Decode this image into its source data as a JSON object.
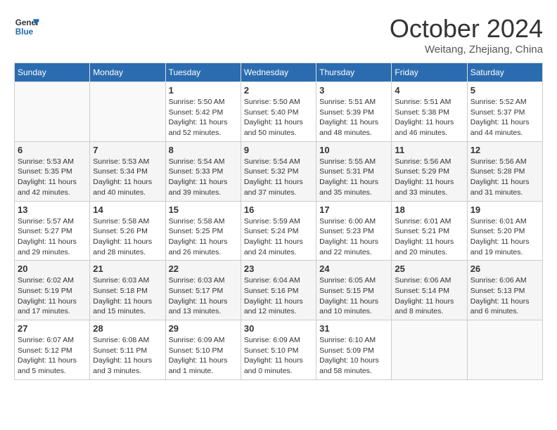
{
  "header": {
    "logo_line1": "General",
    "logo_line2": "Blue",
    "month": "October 2024",
    "location": "Weitang, Zhejiang, China"
  },
  "weekdays": [
    "Sunday",
    "Monday",
    "Tuesday",
    "Wednesday",
    "Thursday",
    "Friday",
    "Saturday"
  ],
  "weeks": [
    [
      {
        "day": "",
        "info": ""
      },
      {
        "day": "",
        "info": ""
      },
      {
        "day": "1",
        "info": "Sunrise: 5:50 AM\nSunset: 5:42 PM\nDaylight: 11 hours\nand 52 minutes."
      },
      {
        "day": "2",
        "info": "Sunrise: 5:50 AM\nSunset: 5:40 PM\nDaylight: 11 hours\nand 50 minutes."
      },
      {
        "day": "3",
        "info": "Sunrise: 5:51 AM\nSunset: 5:39 PM\nDaylight: 11 hours\nand 48 minutes."
      },
      {
        "day": "4",
        "info": "Sunrise: 5:51 AM\nSunset: 5:38 PM\nDaylight: 11 hours\nand 46 minutes."
      },
      {
        "day": "5",
        "info": "Sunrise: 5:52 AM\nSunset: 5:37 PM\nDaylight: 11 hours\nand 44 minutes."
      }
    ],
    [
      {
        "day": "6",
        "info": "Sunrise: 5:53 AM\nSunset: 5:35 PM\nDaylight: 11 hours\nand 42 minutes."
      },
      {
        "day": "7",
        "info": "Sunrise: 5:53 AM\nSunset: 5:34 PM\nDaylight: 11 hours\nand 40 minutes."
      },
      {
        "day": "8",
        "info": "Sunrise: 5:54 AM\nSunset: 5:33 PM\nDaylight: 11 hours\nand 39 minutes."
      },
      {
        "day": "9",
        "info": "Sunrise: 5:54 AM\nSunset: 5:32 PM\nDaylight: 11 hours\nand 37 minutes."
      },
      {
        "day": "10",
        "info": "Sunrise: 5:55 AM\nSunset: 5:31 PM\nDaylight: 11 hours\nand 35 minutes."
      },
      {
        "day": "11",
        "info": "Sunrise: 5:56 AM\nSunset: 5:29 PM\nDaylight: 11 hours\nand 33 minutes."
      },
      {
        "day": "12",
        "info": "Sunrise: 5:56 AM\nSunset: 5:28 PM\nDaylight: 11 hours\nand 31 minutes."
      }
    ],
    [
      {
        "day": "13",
        "info": "Sunrise: 5:57 AM\nSunset: 5:27 PM\nDaylight: 11 hours\nand 29 minutes."
      },
      {
        "day": "14",
        "info": "Sunrise: 5:58 AM\nSunset: 5:26 PM\nDaylight: 11 hours\nand 28 minutes."
      },
      {
        "day": "15",
        "info": "Sunrise: 5:58 AM\nSunset: 5:25 PM\nDaylight: 11 hours\nand 26 minutes."
      },
      {
        "day": "16",
        "info": "Sunrise: 5:59 AM\nSunset: 5:24 PM\nDaylight: 11 hours\nand 24 minutes."
      },
      {
        "day": "17",
        "info": "Sunrise: 6:00 AM\nSunset: 5:23 PM\nDaylight: 11 hours\nand 22 minutes."
      },
      {
        "day": "18",
        "info": "Sunrise: 6:01 AM\nSunset: 5:21 PM\nDaylight: 11 hours\nand 20 minutes."
      },
      {
        "day": "19",
        "info": "Sunrise: 6:01 AM\nSunset: 5:20 PM\nDaylight: 11 hours\nand 19 minutes."
      }
    ],
    [
      {
        "day": "20",
        "info": "Sunrise: 6:02 AM\nSunset: 5:19 PM\nDaylight: 11 hours\nand 17 minutes."
      },
      {
        "day": "21",
        "info": "Sunrise: 6:03 AM\nSunset: 5:18 PM\nDaylight: 11 hours\nand 15 minutes."
      },
      {
        "day": "22",
        "info": "Sunrise: 6:03 AM\nSunset: 5:17 PM\nDaylight: 11 hours\nand 13 minutes."
      },
      {
        "day": "23",
        "info": "Sunrise: 6:04 AM\nSunset: 5:16 PM\nDaylight: 11 hours\nand 12 minutes."
      },
      {
        "day": "24",
        "info": "Sunrise: 6:05 AM\nSunset: 5:15 PM\nDaylight: 11 hours\nand 10 minutes."
      },
      {
        "day": "25",
        "info": "Sunrise: 6:06 AM\nSunset: 5:14 PM\nDaylight: 11 hours\nand 8 minutes."
      },
      {
        "day": "26",
        "info": "Sunrise: 6:06 AM\nSunset: 5:13 PM\nDaylight: 11 hours\nand 6 minutes."
      }
    ],
    [
      {
        "day": "27",
        "info": "Sunrise: 6:07 AM\nSunset: 5:12 PM\nDaylight: 11 hours\nand 5 minutes."
      },
      {
        "day": "28",
        "info": "Sunrise: 6:08 AM\nSunset: 5:11 PM\nDaylight: 11 hours\nand 3 minutes."
      },
      {
        "day": "29",
        "info": "Sunrise: 6:09 AM\nSunset: 5:10 PM\nDaylight: 11 hours\nand 1 minute."
      },
      {
        "day": "30",
        "info": "Sunrise: 6:09 AM\nSunset: 5:10 PM\nDaylight: 11 hours\nand 0 minutes."
      },
      {
        "day": "31",
        "info": "Sunrise: 6:10 AM\nSunset: 5:09 PM\nDaylight: 10 hours\nand 58 minutes."
      },
      {
        "day": "",
        "info": ""
      },
      {
        "day": "",
        "info": ""
      }
    ]
  ]
}
